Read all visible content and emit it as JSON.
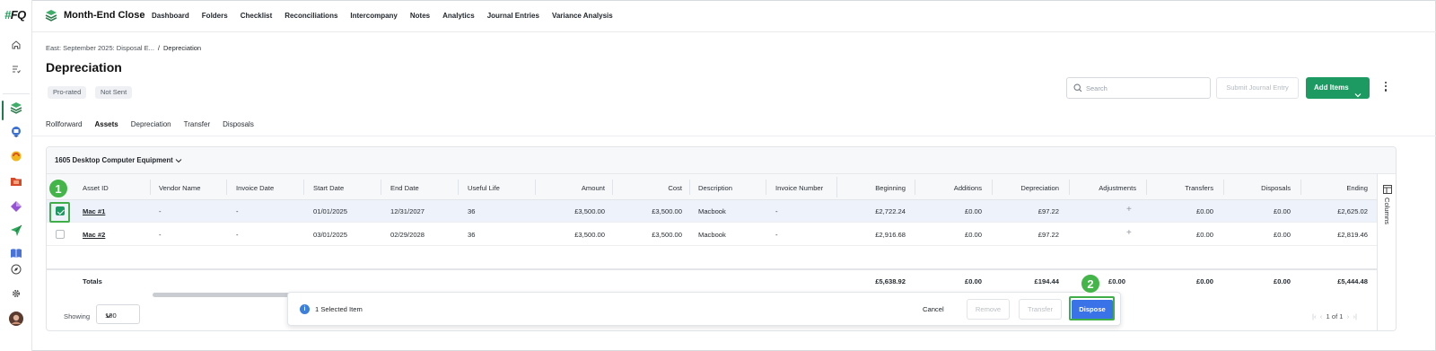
{
  "app": {
    "logo_text": "FQ",
    "title": "Month-End Close",
    "nav": [
      "Dashboard",
      "Folders",
      "Checklist",
      "Reconciliations",
      "Intercompany",
      "Notes",
      "Analytics",
      "Journal Entries",
      "Variance Analysis"
    ]
  },
  "sidebar": {
    "icons": [
      "home-icon",
      "tasks-icon",
      "month-end-close-icon",
      "reports-icon",
      "integrations-icon",
      "folder-icon",
      "diamond-icon",
      "send-icon",
      "library-icon",
      "compass-icon",
      "settings-icon",
      "user-avatar"
    ]
  },
  "header": {
    "breadcrumb_parent": "East: September 2025: Disposal E...",
    "breadcrumb_sep": "/",
    "breadcrumb_current": "Depreciation",
    "title": "Depreciation",
    "badges": [
      "Pro-rated",
      "Not Sent"
    ],
    "search_placeholder": "Search",
    "submit_label": "Submit Journal Entry",
    "add_label": "Add Items"
  },
  "tabs": [
    "Rollforward",
    "Assets",
    "Depreciation",
    "Transfer",
    "Disposals"
  ],
  "active_tab": "Assets",
  "table": {
    "group_label": "1605 Desktop Computer Equipment",
    "columns": [
      "Asset ID",
      "Vendor Name",
      "Invoice Date",
      "Start Date",
      "End Date",
      "Useful Life",
      "Amount",
      "Cost",
      "Description",
      "Invoice Number",
      "Beginning",
      "Additions",
      "Depreciation",
      "Adjustments",
      "Transfers",
      "Disposals",
      "Ending"
    ],
    "rows": [
      {
        "selected": true,
        "asset_id": "Mac #1",
        "vendor": "-",
        "invoice_date": "-",
        "start": "01/01/2025",
        "end": "12/31/2027",
        "life": "36",
        "amount": "£3,500.00",
        "cost": "£3,500.00",
        "desc": "Macbook",
        "invoice_no": "-",
        "beginning": "£2,722.24",
        "additions": "£0.00",
        "depreciation": "£97.22",
        "adjustments": "+",
        "transfers": "£0.00",
        "disposals": "£0.00",
        "ending": "£2,625.02"
      },
      {
        "selected": false,
        "asset_id": "Mac #2",
        "vendor": "-",
        "invoice_date": "-",
        "start": "03/01/2025",
        "end": "02/29/2028",
        "life": "36",
        "amount": "£3,500.00",
        "cost": "£3,500.00",
        "desc": "Macbook",
        "invoice_no": "-",
        "beginning": "£2,916.68",
        "additions": "£0.00",
        "depreciation": "£97.22",
        "adjustments": "+",
        "transfers": "£0.00",
        "disposals": "£0.00",
        "ending": "£2,819.46"
      }
    ],
    "totals": {
      "label": "Totals",
      "beginning": "£5,638.92",
      "additions": "£0.00",
      "depreciation": "£194.44",
      "adjustments": "£0.00",
      "transfers": "£0.00",
      "disposals": "£0.00",
      "ending": "£5,444.48"
    },
    "columns_rail_label": "Columns"
  },
  "footer": {
    "showing_label": "Showing",
    "page_size": "100",
    "pager_text": "1 of 1"
  },
  "action_bar": {
    "selected_text": "1 Selected Item",
    "cancel_label": "Cancel",
    "remove_label": "Remove",
    "transfer_label": "Transfer",
    "dispose_label": "Dispose"
  },
  "markers": [
    "1",
    "2"
  ],
  "colors": {
    "brand_green": "#1d9a62",
    "dispose_blue": "#3a73e8",
    "marker_green": "#43b549"
  }
}
